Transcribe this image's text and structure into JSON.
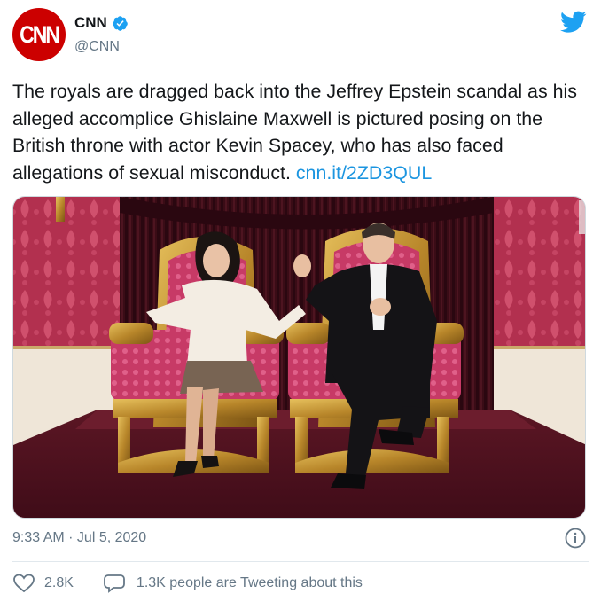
{
  "account": {
    "avatar_text": "CNN",
    "display_name": "CNN",
    "handle": "@CNN",
    "verified": true
  },
  "tweet": {
    "text": "The royals are dragged back into the Jeffrey Epstein scandal as his alleged accomplice Ghislaine Maxwell is pictured posing on the British throne with actor Kevin Spacey, who has also faced allegations of sexual misconduct.",
    "link": "cnn.it/2ZD3QUL",
    "timestamp": "9:33 AM · Jul 5, 2020"
  },
  "actions": {
    "like_count": "2.8K",
    "people_tweeting": "1.3K people are Tweeting about this"
  },
  "colors": {
    "brand_red": "#cc0000",
    "twitter_blue": "#1da1f2",
    "link_blue": "#1b95e0",
    "secondary_text": "#657786"
  },
  "icons": [
    "verified-badge-icon",
    "twitter-bird-icon",
    "info-icon",
    "heart-icon",
    "speech-bubble-icon"
  ]
}
